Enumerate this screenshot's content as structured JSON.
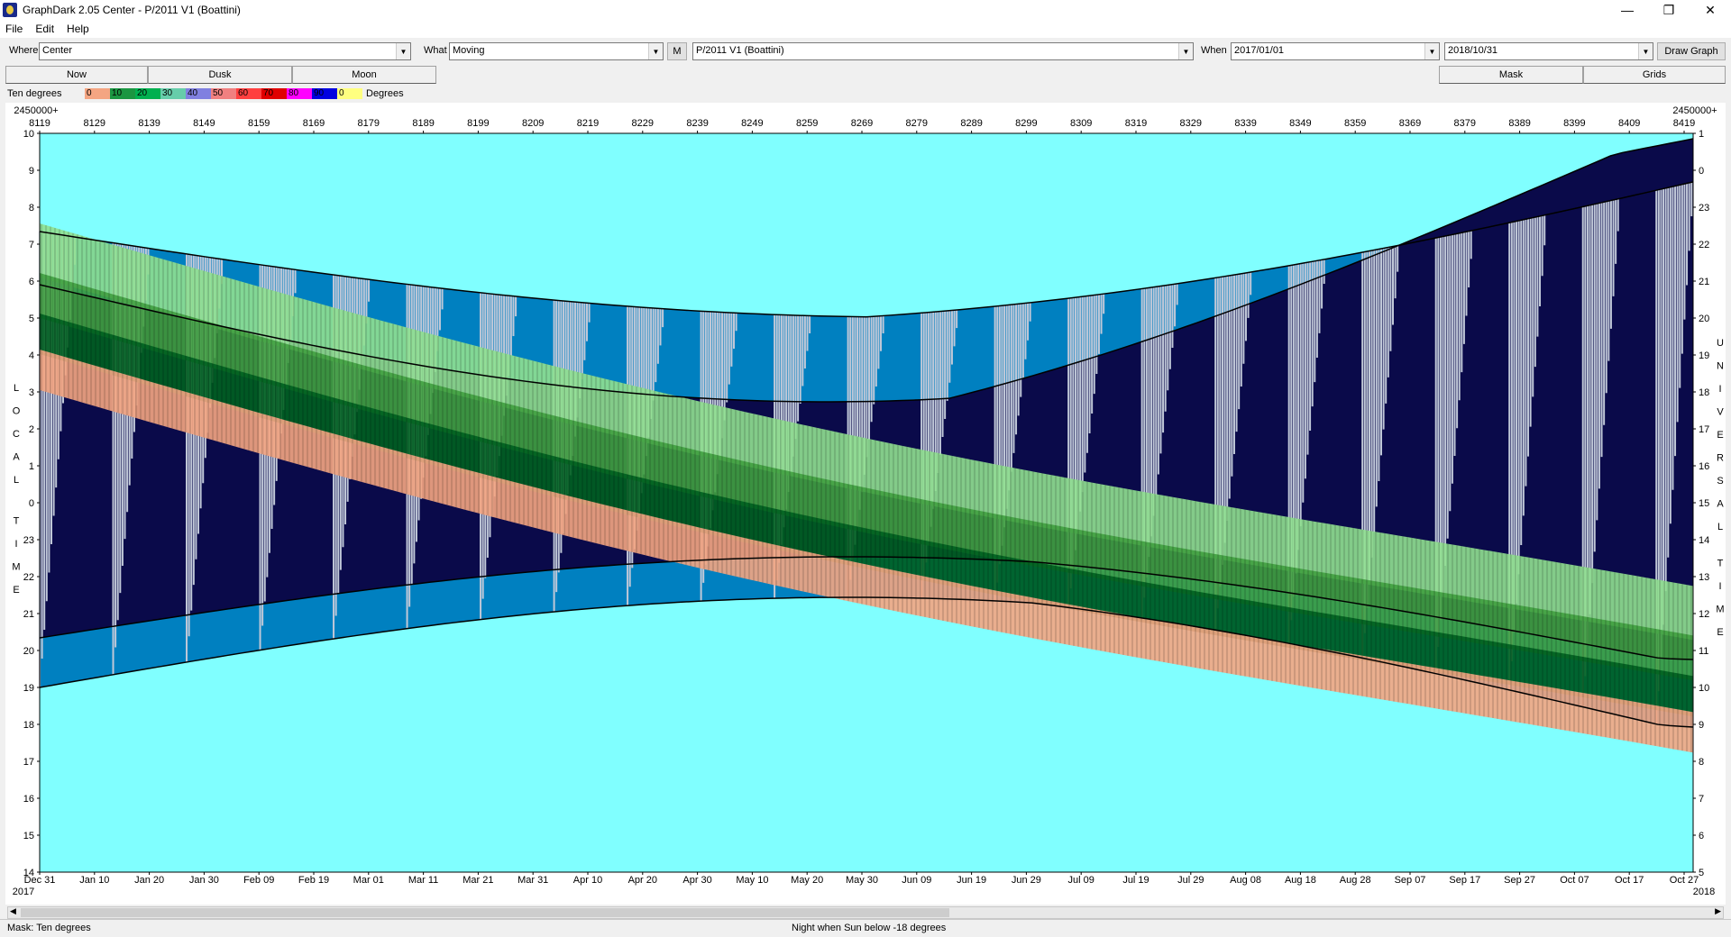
{
  "window": {
    "title": "GraphDark 2.05  Center  -  P/2011 V1 (Boattini)",
    "minimize": "—",
    "restore": "❐",
    "close": "✕"
  },
  "menu": [
    "File",
    "Edit",
    "Help"
  ],
  "toolbar": {
    "where_label": "Where",
    "where_value": "Center",
    "what_label": "What",
    "what_value": "Moving",
    "m_button": "M",
    "object_value": "P/2011 V1 (Boattini)",
    "when_label": "When",
    "when_start": "2017/01/01",
    "when_end": "2018/10/31",
    "draw_button": "Draw Graph"
  },
  "tabs": {
    "now": "Now",
    "dusk": "Dusk",
    "moon": "Moon",
    "mask": "Mask",
    "grids": "Grids"
  },
  "legend": {
    "label": "Ten degrees",
    "swatches": [
      {
        "text": "0",
        "color": "#f4a582"
      },
      {
        "text": "10",
        "color": "#1a9641"
      },
      {
        "text": "20",
        "color": "#00b050"
      },
      {
        "text": "30",
        "color": "#66cdaa"
      },
      {
        "text": "40",
        "color": "#8080e0"
      },
      {
        "text": "50",
        "color": "#f08080"
      },
      {
        "text": "60",
        "color": "#ff4040"
      },
      {
        "text": "70",
        "color": "#e00000"
      },
      {
        "text": "80",
        "color": "#ff00ff"
      },
      {
        "text": "90",
        "color": "#0000e0"
      },
      {
        "text": "0",
        "color": "#ffff80"
      }
    ],
    "units": "Degrees"
  },
  "graph": {
    "jd_prefix_left": "2450000+",
    "jd_prefix_right": "2450000+",
    "jd_ticks": [
      "8119",
      "8129",
      "8139",
      "8149",
      "8159",
      "8169",
      "8179",
      "8189",
      "8199",
      "8209",
      "8219",
      "8229",
      "8239",
      "8249",
      "8259",
      "8269",
      "8279",
      "8289",
      "8299",
      "8309",
      "8319",
      "8329",
      "8339",
      "8349",
      "8359",
      "8369",
      "8379",
      "8389",
      "8399",
      "8409",
      "8419"
    ],
    "date_ticks": [
      "Dec 31",
      "Jan 10",
      "Jan 20",
      "Jan 30",
      "Feb 09",
      "Feb 19",
      "Mar 01",
      "Mar 11",
      "Mar 21",
      "Mar 31",
      "Apr 10",
      "Apr 20",
      "Apr 30",
      "May 10",
      "May 20",
      "May 30",
      "Jun 09",
      "Jun 19",
      "Jun 29",
      "Jul 09",
      "Jul 19",
      "Jul 29",
      "Aug 08",
      "Aug 18",
      "Aug 28",
      "Sep 07",
      "Sep 17",
      "Sep 27",
      "Oct 07",
      "Oct 17",
      "Oct 27"
    ],
    "year_left_top": "2017",
    "year_left_bottom": "2017",
    "year_right_bottom": "2018",
    "local_time_ticks": [
      "10",
      "9",
      "8",
      "7",
      "6",
      "5",
      "4",
      "3",
      "2",
      "1",
      "0",
      "23",
      "22",
      "21",
      "20",
      "19",
      "18",
      "17",
      "16",
      "15",
      "14"
    ],
    "ut_ticks": [
      "1",
      "0",
      "23",
      "22",
      "21",
      "20",
      "19",
      "18",
      "17",
      "16",
      "15",
      "14",
      "13",
      "12",
      "11",
      "10",
      "9",
      "8",
      "7",
      "6",
      "5"
    ],
    "left_axis_title": "LOCAL TIME",
    "right_axis_title": "UNIVERSAL TIME",
    "colors": {
      "day": "#80ffff",
      "night": "#0a0a4a",
      "twilight_dark": "#0080c0",
      "twilight_light": "#c0c8d8",
      "band_orange": "#f4a582",
      "band_light_green": "#90e090",
      "band_mid_green": "#40a040",
      "band_dark_green": "#006020",
      "band_teal": "#00a080"
    }
  },
  "status": {
    "mask": "Mask:  Ten degrees",
    "note": "Night when Sun below -18 degrees"
  }
}
